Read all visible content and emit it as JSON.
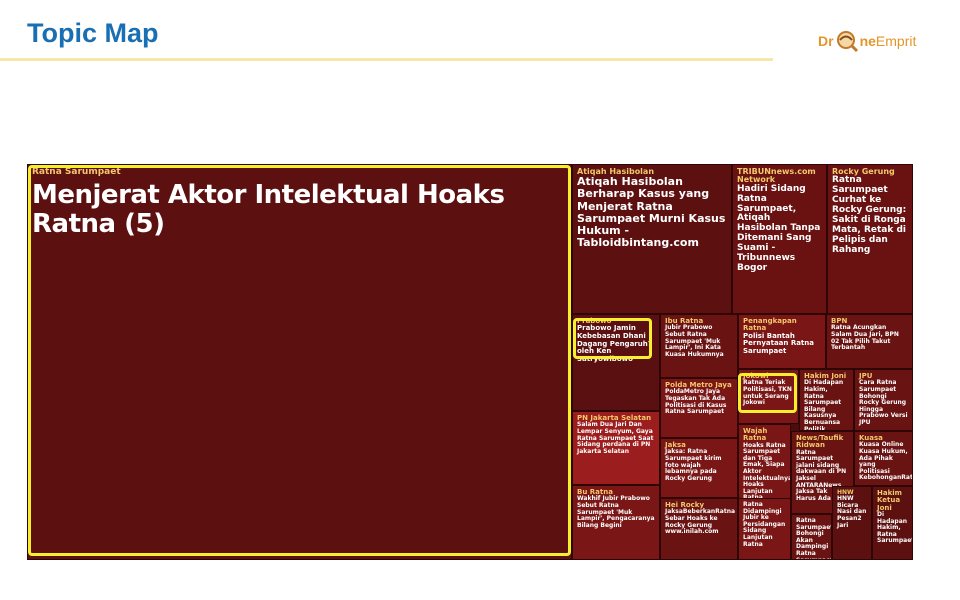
{
  "header": {
    "title": "Topic Map"
  },
  "logo": {
    "part1": "Dr",
    "part2": "ne",
    "part3": "Emprit",
    "icon": "drone-magnifier-icon"
  },
  "colors": {
    "title": "#1a6fb3",
    "accent": "#f5ef2d",
    "cell_dark": "#5c1010",
    "cell_mid": "#7a1616",
    "cell_red": "#9c1d1d",
    "label": "#f2c96b"
  },
  "chart_data": {
    "type": "treemap",
    "cells": [
      {
        "label": "Ratna Sarumpaet",
        "text": "Menjerat Aktor Intelektual Hoaks Ratna (5)",
        "highlighted": true
      },
      {
        "label": "Atiqah Hasibolan",
        "text": "Atiqah Hasibolan Berharap Kasus yang Menjerat Ratna Sarumpaet Murni Kasus Hukum - Tabloidbintang.com"
      },
      {
        "label": "TRIBUNnews.com Network",
        "text": "Hadiri Sidang Ratna Sarumpaet, Atiqah Hasibolan Tanpa Ditemani Sang Suami - Tribunnews Bogor"
      },
      {
        "label": "Rocky Gerung",
        "text": "Ratna Sarumpaet Curhat ke Rocky Gerung: Sakit di Ronga Mata, Retak di Pelipis dan Rahang"
      },
      {
        "label": "Prabowo",
        "text": "Prabowo Jamin Kebebasan Dhani Dagang Pengaruh? oleh Ken Satryowibowo",
        "highlighted": true
      },
      {
        "label": "Ibu Ratna",
        "text": "Jubir Prabowo Sebut Ratna Sarumpaet 'Muk Lampir', Ini Kata Kuasa Hukumnya"
      },
      {
        "label": "Penangkapan Ratna",
        "text": "Polisi Bantah Pernyataan Ratna Sarumpaet"
      },
      {
        "label": "BPN",
        "text": "Ratna Acungkan Salam Dua Jari, BPN 02 Tak Pilih Takut Terbantah"
      },
      {
        "label": "Polda Metro Jaya",
        "text": "PoldaMetro Jaya Tegaskan Tak Ada Politisasi di Kasus Ratna Sarumpaet"
      },
      {
        "label": "Jokowi",
        "text": "Ratna Teriak Politisasi, TKN untuk Serang Jokowi",
        "highlighted": true
      },
      {
        "label": "Hakim Joni",
        "text": "Di Hadapan Hakim, Ratna Sarumpaet Bilang Kasusnya Bernuansa Politik"
      },
      {
        "label": "JPU",
        "text": "Cara Ratna Sarumpaet Bohongi Rocky Gerung Hingga Prabowo Versi JPU"
      },
      {
        "label": "PN Jakarta Selatan",
        "text": "Salam Dua Jari Dan Lempar Senyum, Gaya Ratna Sarumpaet Saat Sidang perdana di PN Jakarta Selatan"
      },
      {
        "label": "Jaksa",
        "text": "Jaksa: Ratna Sarumpaet kirim foto wajah lebamnya pada Rocky Gerung"
      },
      {
        "label": "Wajah Ratna",
        "text": "Hoaks Ratna Sarumpaet dan Tiga Emak, Siapa Aktor Intelektualnya? Hoaks Lanjutan Ratna"
      },
      {
        "label": "News/Taufik Ridwan",
        "text": "Ratna Sarumpaet jalani sidang dakwaan di PN Jaksel ANTARANews Jaksa Tak Harus Ada"
      },
      {
        "label": "Kuasa",
        "text": "Kuasa Online Kuasa Hukum, Ada Pihak yang Politisasi KebohonganRatna"
      },
      {
        "label": "Bu Ratna",
        "text": "Wakhif Jubir Prabowo Sebut Ratna Sarumpaet 'Muk Lampir', Pengacaranya Bilang Begini"
      },
      {
        "label": "Hei Rocky",
        "text": "JaksaBeberkanRatna Sebar Hoaks ke Rocky Gerung www.inilah.com"
      },
      {
        "label": "HNW",
        "text": "HNW Bicara Nasi dan Pesan2 Jari"
      },
      {
        "label": "Hakim Ketua Joni",
        "text": "Di Hadapan Hakim, Ratna Sarumpaet"
      },
      {
        "label": "",
        "text": "Ratna Sarumpaet Bohongi Akan Dampingi Ratna Sarumpaet"
      },
      {
        "label": "",
        "text": "Ratna Didampingi Jubir ke Persidangan Sidang Lanjutan Ratna"
      }
    ]
  }
}
